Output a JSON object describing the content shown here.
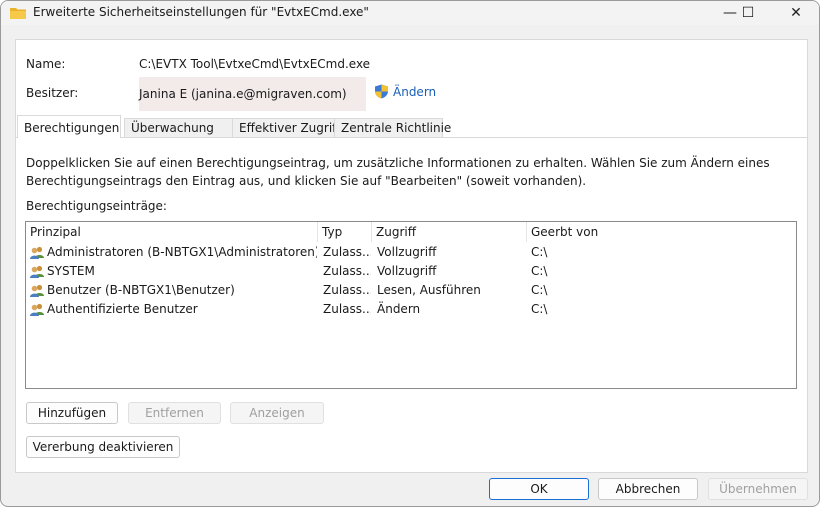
{
  "window": {
    "title": "Erweiterte Sicherheitseinstellungen für \"EvtxECmd.exe\"",
    "minimize_glyph": "—",
    "maximize_glyph": "☐",
    "close_glyph": "✕"
  },
  "fields": {
    "name_label": "Name:",
    "name_value": "C:\\EVTX Tool\\EvtxeCmd\\EvtxECmd.exe",
    "owner_label": "Besitzer:",
    "owner_value": "Janina E (janina.e@migraven.com)",
    "change_label": "Ändern"
  },
  "tabs": [
    {
      "label": "Berechtigungen",
      "active": true
    },
    {
      "label": "Überwachung",
      "active": false
    },
    {
      "label": "Effektiver Zugriff",
      "active": false
    },
    {
      "label": "Zentrale Richtlinie",
      "active": false
    }
  ],
  "description": "Doppelklicken Sie auf einen Berechtigungseintrag, um zusätzliche Informationen zu erhalten. Wählen Sie zum Ändern eines Berechtigungseintrags den Eintrag aus, und klicken Sie auf \"Bearbeiten\" (soweit vorhanden).",
  "entries_label": "Berechtigungseinträge:",
  "columns": [
    "Prinzipal",
    "Typ",
    "Zugriff",
    "Geerbt von"
  ],
  "rows": [
    {
      "principal": "Administratoren (B-NBTGX1\\Administratoren)",
      "type": "Zulass...",
      "access": "Vollzugriff",
      "inherited": "C:\\"
    },
    {
      "principal": "SYSTEM",
      "type": "Zulass...",
      "access": "Vollzugriff",
      "inherited": "C:\\"
    },
    {
      "principal": "Benutzer (B-NBTGX1\\Benutzer)",
      "type": "Zulass...",
      "access": "Lesen, Ausführen",
      "inherited": "C:\\"
    },
    {
      "principal": "Authentifizierte Benutzer",
      "type": "Zulass...",
      "access": "Ändern",
      "inherited": "C:\\"
    }
  ],
  "buttons": {
    "add": "Hinzufügen",
    "remove": "Entfernen",
    "view": "Anzeigen",
    "disable_inheritance": "Vererbung deaktivieren",
    "ok": "OK",
    "cancel": "Abbrechen",
    "apply": "Übernehmen"
  },
  "icons": {
    "title": "folder-icon",
    "change": "shield-icon",
    "user": "users-icon"
  },
  "colors": {
    "accent": "#1a6fd4",
    "link": "#1a5fb4",
    "owner_highlight": "#f3eaea"
  }
}
